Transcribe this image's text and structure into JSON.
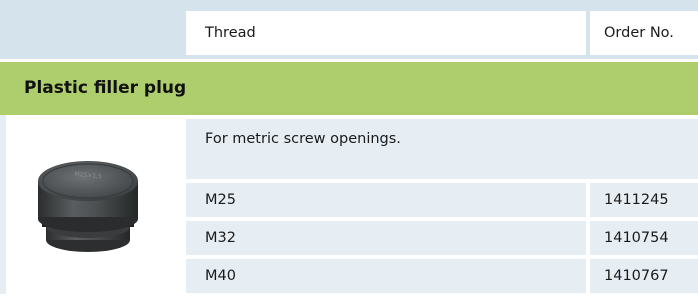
{
  "header": {
    "thread_label": "Thread",
    "order_label": "Order No."
  },
  "section": {
    "title": "Plastic filler plug",
    "description": "For metric screw openings.",
    "image_label": "Plastic filler plug product photo",
    "cap_marking": "M25×1,5"
  },
  "rows": [
    {
      "thread": "M25",
      "order": "1411245"
    },
    {
      "thread": "M32",
      "order": "1410754"
    },
    {
      "thread": "M40",
      "order": "1410767"
    }
  ],
  "colors": {
    "header_band": "#d4e3ec",
    "title_band": "#aecd6c",
    "row_bg": "#e6eef4"
  }
}
